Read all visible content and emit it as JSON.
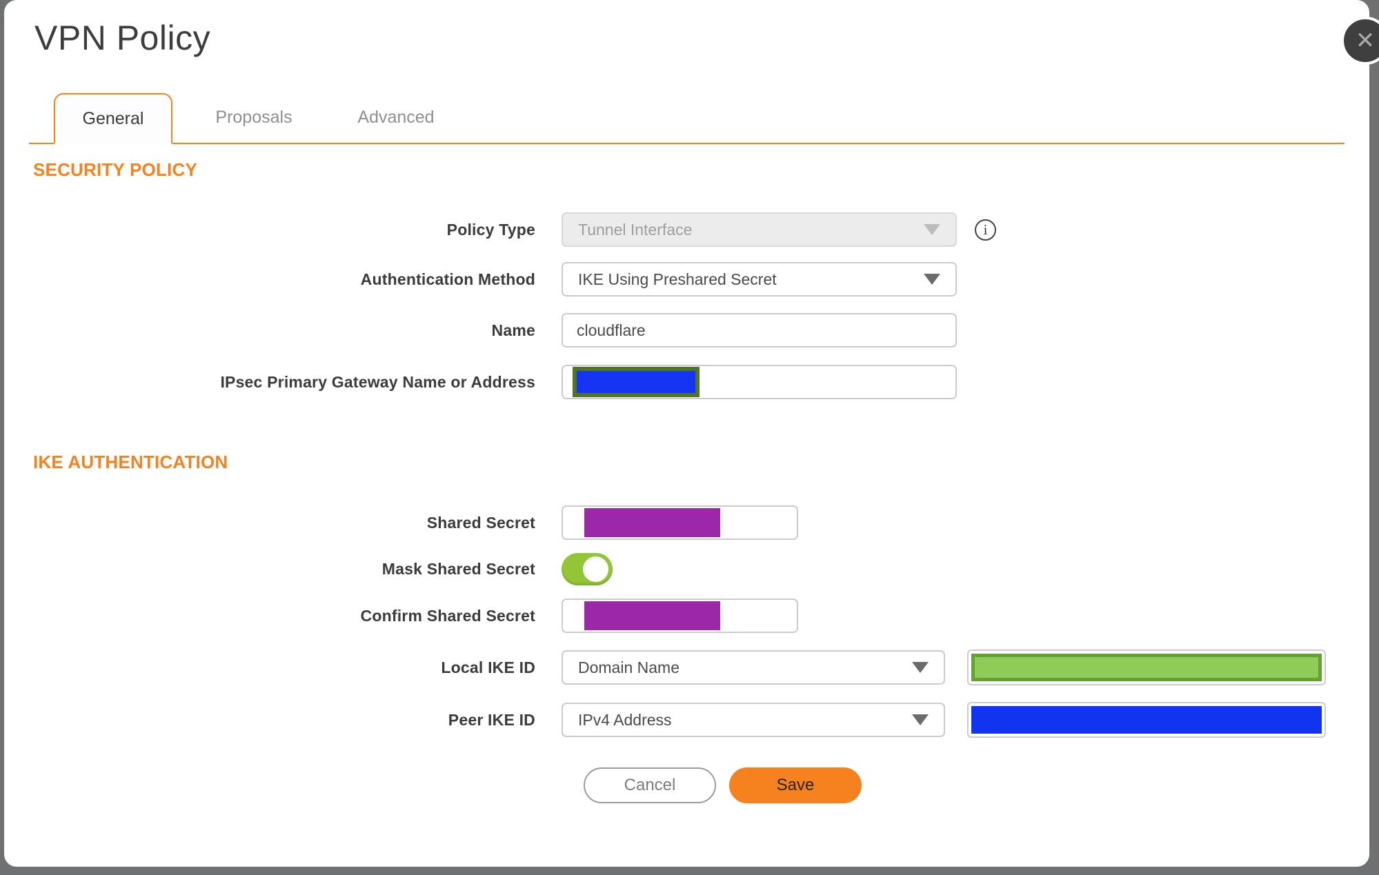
{
  "modal": {
    "title": "VPN Policy",
    "close_icon": "✕"
  },
  "tabs": [
    {
      "label": "General",
      "active": true
    },
    {
      "label": "Proposals",
      "active": false
    },
    {
      "label": "Advanced",
      "active": false
    }
  ],
  "sections": {
    "security_policy": "SECURITY POLICY",
    "ike_authentication": "IKE AUTHENTICATION"
  },
  "fields": {
    "policy_type": {
      "label": "Policy Type",
      "value": "Tunnel Interface",
      "disabled": true
    },
    "auth_method": {
      "label": "Authentication Method",
      "value": "IKE Using Preshared Secret"
    },
    "name": {
      "label": "Name",
      "value": "cloudflare"
    },
    "gateway": {
      "label": "IPsec Primary Gateway Name or Address",
      "value_redacted": true
    },
    "shared_secret": {
      "label": "Shared Secret",
      "value_redacted": true
    },
    "mask_shared_secret": {
      "label": "Mask Shared Secret",
      "state": "on"
    },
    "confirm_shared_secret": {
      "label": "Confirm Shared Secret",
      "value_redacted": true
    },
    "local_ike_id": {
      "label": "Local IKE ID",
      "value": "Domain Name",
      "id_value_redacted": true
    },
    "peer_ike_id": {
      "label": "Peer IKE ID",
      "value": "IPv4 Address",
      "id_value_redacted": true
    }
  },
  "icons": {
    "info": "i"
  },
  "buttons": {
    "cancel": "Cancel",
    "save": "Save"
  },
  "colors": {
    "accent_orange": "#F6821F",
    "redaction_purple": "#9C27A8",
    "redaction_blue": "#1134F0",
    "redaction_gateway_blue": "#1535F5",
    "redaction_gateway_border": "#4F7527",
    "redaction_green": "#8FCB57",
    "redaction_green_border": "#63A135",
    "toggle_green": "#92C636",
    "backdrop_gray": "#6E7072"
  }
}
